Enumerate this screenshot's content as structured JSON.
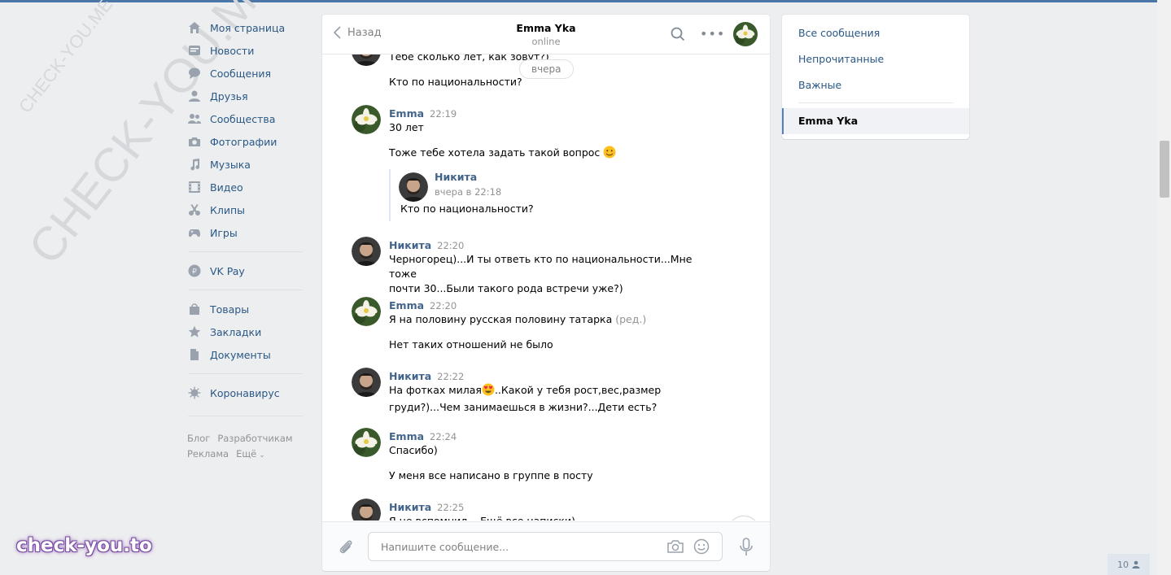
{
  "watermarks": {
    "small": "CHECK-YOU.ME",
    "large": "CHECK-YOU.ME",
    "logo": "check-you.to"
  },
  "nav": {
    "items": [
      {
        "label": "Моя страница",
        "icon": "home-icon"
      },
      {
        "label": "Новости",
        "icon": "news-icon"
      },
      {
        "label": "Сообщения",
        "icon": "messages-icon"
      },
      {
        "label": "Друзья",
        "icon": "friends-icon"
      },
      {
        "label": "Сообщества",
        "icon": "communities-icon"
      },
      {
        "label": "Фотографии",
        "icon": "camera-icon"
      },
      {
        "label": "Музыка",
        "icon": "music-icon"
      },
      {
        "label": "Видео",
        "icon": "video-icon"
      },
      {
        "label": "Клипы",
        "icon": "clips-icon"
      },
      {
        "label": "Игры",
        "icon": "gamepad-icon"
      }
    ],
    "vkpay": "VK Pay",
    "group2": [
      {
        "label": "Товары",
        "icon": "bag-icon"
      },
      {
        "label": "Закладки",
        "icon": "star-icon"
      },
      {
        "label": "Документы",
        "icon": "document-icon"
      }
    ],
    "corona": "Коронавирус"
  },
  "footer": {
    "blog": "Блог",
    "dev": "Разработчикам",
    "ads": "Реклама",
    "more": "Ещё"
  },
  "chat": {
    "back_label": "Назад",
    "peer_name": "Emma Yka",
    "peer_status": "online",
    "date_pill": "вчера",
    "messages": {
      "m0": {
        "text1": "Тебе сколько лет, как зовут?)",
        "text2": "Кто по национальности?"
      },
      "m1": {
        "author": "Emma",
        "time": "22:19",
        "text1": "30 лет",
        "text2": "Тоже тебе хотела задать такой вопрос",
        "fwd": {
          "author": "Никита",
          "time": "вчера в 22:18",
          "text": "Кто по национальности?"
        }
      },
      "m2": {
        "author": "Никита",
        "time": "22:20",
        "text1": "Черногорец)...И ты ответь кто по национальности...Мне тоже",
        "text2": "почти 30...Были такого рода встречи уже?)"
      },
      "m3": {
        "author": "Emma",
        "time": "22:20",
        "text1": "Я на половину русская половину татарка",
        "edited": "(ред.)",
        "text2": "Нет таких отношений не было"
      },
      "m4": {
        "author": "Никита",
        "time": "22:22",
        "text1a": "На фотках милая",
        "text1b": "..Какой у тебя рост,вес,размер",
        "text2": "груди?)...Чем занимаешься в жизни?...Дети есть?"
      },
      "m5": {
        "author": "Emma",
        "time": "22:24",
        "text1": "Спасибо)",
        "text2": "У меня все написано в группе в посту"
      },
      "m6": {
        "author": "Никита",
        "time": "22:25",
        "text1": "Я не вспомнил... Ещё все написки)"
      }
    },
    "composer": {
      "placeholder": "Напишите сообщение..."
    }
  },
  "filters": {
    "all": "Все сообщения",
    "unread": "Непрочитанные",
    "important": "Важные",
    "active_chat": "Emma Yka"
  },
  "online_count": "10",
  "colors": {
    "accent": "#4a76a8",
    "link": "#2a5885",
    "author": "#42648b"
  }
}
